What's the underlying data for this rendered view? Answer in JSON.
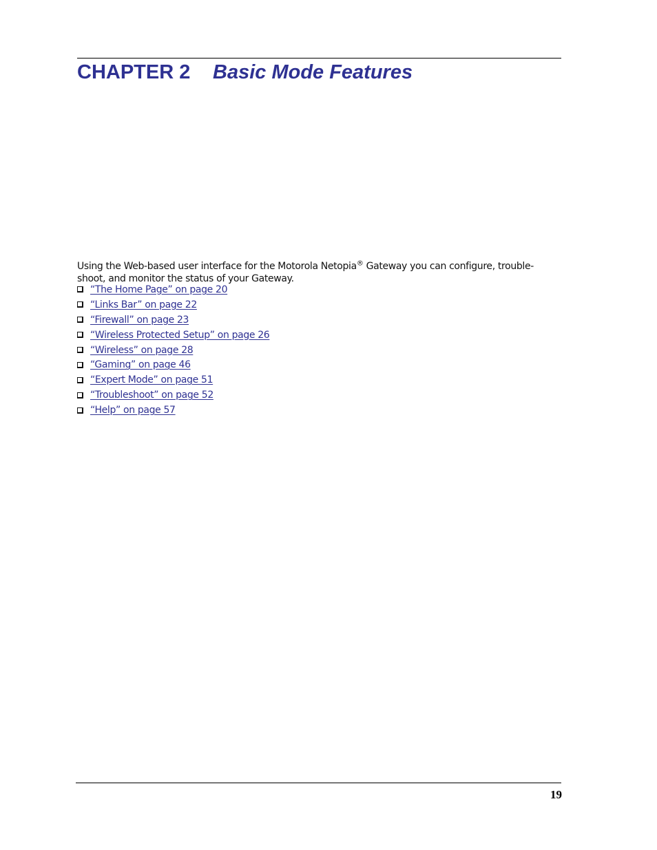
{
  "header": {
    "chapter_label": "CHAPTER 2",
    "chapter_title": "Basic Mode Features"
  },
  "intro": {
    "text_before": "Using the Web-based user interface for the Motorola Netopia",
    "registered_mark": "®",
    "text_after": " Gateway you can configure, trouble-shoot, and monitor the status of your Gateway."
  },
  "links": [
    {
      "label": "“The Home Page” on page 20"
    },
    {
      "label": "“Links Bar” on page 22"
    },
    {
      "label": "“Firewall” on page 23"
    },
    {
      "label": "“Wireless Protected Setup” on page 26"
    },
    {
      "label": "“Wireless” on page 28"
    },
    {
      "label": "“Gaming” on page 46"
    },
    {
      "label": "“Expert Mode” on page 51"
    },
    {
      "label": "“Troubleshoot” on page 52"
    },
    {
      "label": "“Help” on page 57"
    }
  ],
  "footer": {
    "page_number": "19"
  },
  "colors": {
    "heading": "#2e3192",
    "link": "#2e3192"
  }
}
